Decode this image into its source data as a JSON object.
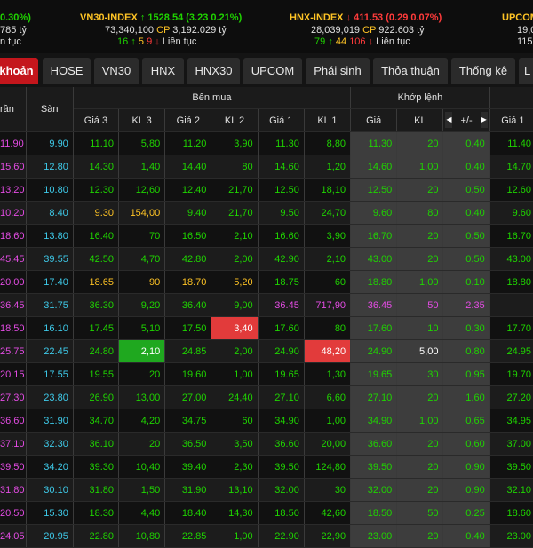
{
  "ticker": {
    "vnindex": {
      "change": "0.30%)",
      "value_line": "785 tỷ",
      "breadth_line": "n tục"
    },
    "vn30": {
      "name": "VN30-INDEX",
      "arrow": "↑",
      "value": "1528.54",
      "change": "(3.23  0.21%)",
      "volume": "73,340,100",
      "cp_label": "CP",
      "value_bn": "3,192.029 tỷ",
      "adv": "16",
      "adv_arrow": "↑",
      "unch": "5",
      "dec": "9",
      "dec_arrow": "↓",
      "session": "Liên tục"
    },
    "hnx": {
      "name": "HNX-INDEX",
      "arrow": "↓",
      "value": "411.53",
      "change": "(0.29  0.07%)",
      "volume": "28,039,019",
      "cp_label": "CP",
      "value_bn": "922.603 tỷ",
      "adv": "79",
      "adv_arrow": "↑",
      "unch": "44",
      "dec": "106",
      "dec_arrow": "↓",
      "session": "Liên tục"
    },
    "upcom": {
      "name": "UPCOM",
      "value_line": "19,0",
      "breadth_line": "115"
    }
  },
  "tabs": [
    "khoản",
    "HOSE",
    "VN30",
    "HNX",
    "HNX30",
    "UPCOM",
    "Phái sinh",
    "Thỏa thuận",
    "Thống kê",
    "L"
  ],
  "headers": {
    "ceiling": "rần",
    "floor": "Sàn",
    "bid_group": "Bên mua",
    "match_group": "Khớp lệnh",
    "bid_p3": "Giá 3",
    "bid_v3": "KL 3",
    "bid_p2": "Giá 2",
    "bid_v2": "KL 2",
    "bid_p1": "Giá 1",
    "bid_v1": "KL 1",
    "match_price": "Giá",
    "match_vol": "KL",
    "match_change": "+/-",
    "ask_p1": "Giá 1",
    "nav_left": "◀",
    "nav_right": "▶"
  },
  "rows": [
    {
      "ceil": "11.90",
      "floor": "9.90",
      "p3": "11.10",
      "v3": "5,80",
      "p2": "11.20",
      "v2": "3,90",
      "p1": "11.30",
      "v1": "8,80",
      "mp": "11.30",
      "mv": "20",
      "chg": "0.40",
      "a1": "11.40"
    },
    {
      "ceil": "15.60",
      "floor": "12.80",
      "p3": "14.30",
      "v3": "1,40",
      "p2": "14.40",
      "v2": "80",
      "p1": "14.60",
      "v1": "1,20",
      "mp": "14.60",
      "mv": "1,00",
      "chg": "0.40",
      "a1": "14.70"
    },
    {
      "ceil": "13.20",
      "floor": "10.80",
      "p3": "12.30",
      "v3": "12,60",
      "p2": "12.40",
      "v2": "21,70",
      "p1": "12.50",
      "v1": "18,10",
      "mp": "12.50",
      "mv": "20",
      "chg": "0.50",
      "a1": "12.60"
    },
    {
      "ceil": "10.20",
      "floor": "8.40",
      "p3": "9.30",
      "v3": "154,00",
      "p2": "9.40",
      "v2": "21,70",
      "p1": "9.50",
      "v1": "24,70",
      "mp": "9.60",
      "mv": "80",
      "chg": "0.40",
      "a1": "9.60"
    },
    {
      "ceil": "18.60",
      "floor": "13.80",
      "p3": "16.40",
      "v3": "70",
      "p2": "16.50",
      "v2": "2,10",
      "p1": "16.60",
      "v1": "3,90",
      "mp": "16.70",
      "mv": "20",
      "chg": "0.50",
      "a1": "16.70"
    },
    {
      "ceil": "45.45",
      "floor": "39.55",
      "p3": "42.50",
      "v3": "4,70",
      "p2": "42.80",
      "v2": "2,00",
      "p1": "42.90",
      "v1": "2,10",
      "mp": "43.00",
      "mv": "20",
      "chg": "0.50",
      "a1": "43.00"
    },
    {
      "ceil": "20.00",
      "floor": "17.40",
      "p3": "18.65",
      "v3": "90",
      "p2": "18.70",
      "v2": "5,20",
      "p1": "18.75",
      "v1": "60",
      "mp": "18.80",
      "mv": "1,00",
      "chg": "0.10",
      "a1": "18.80"
    },
    {
      "ceil": "36.45",
      "floor": "31.75",
      "p3": "36.30",
      "v3": "9,20",
      "p2": "36.40",
      "v2": "9,00",
      "p1": "36.45",
      "v1": "717,90",
      "mp": "36.45",
      "mv": "50",
      "chg": "2.35",
      "a1": ""
    },
    {
      "ceil": "18.50",
      "floor": "16.10",
      "p3": "17.45",
      "v3": "5,10",
      "p2": "17.50",
      "v2": "3,40",
      "p1": "17.60",
      "v1": "80",
      "mp": "17.60",
      "mv": "10",
      "chg": "0.30",
      "a1": "17.70"
    },
    {
      "ceil": "25.75",
      "floor": "22.45",
      "p3": "24.80",
      "v3": "2,10",
      "p2": "24.85",
      "v2": "2,00",
      "p1": "24.90",
      "v1": "48,20",
      "mp": "24.90",
      "mv": "5,00",
      "chg": "0.80",
      "a1": "24.95"
    },
    {
      "ceil": "20.15",
      "floor": "17.55",
      "p3": "19.55",
      "v3": "20",
      "p2": "19.60",
      "v2": "1,00",
      "p1": "19.65",
      "v1": "1,30",
      "mp": "19.65",
      "mv": "30",
      "chg": "0.95",
      "a1": "19.70"
    },
    {
      "ceil": "27.30",
      "floor": "23.80",
      "p3": "26.90",
      "v3": "13,00",
      "p2": "27.00",
      "v2": "24,40",
      "p1": "27.10",
      "v1": "6,60",
      "mp": "27.10",
      "mv": "20",
      "chg": "1.60",
      "a1": "27.20"
    },
    {
      "ceil": "36.60",
      "floor": "31.90",
      "p3": "34.70",
      "v3": "4,20",
      "p2": "34.75",
      "v2": "60",
      "p1": "34.90",
      "v1": "1,00",
      "mp": "34.90",
      "mv": "1,00",
      "chg": "0.65",
      "a1": "34.95"
    },
    {
      "ceil": "37.10",
      "floor": "32.30",
      "p3": "36.10",
      "v3": "20",
      "p2": "36.50",
      "v2": "3,50",
      "p1": "36.60",
      "v1": "20,00",
      "mp": "36.60",
      "mv": "20",
      "chg": "0.60",
      "a1": "37.00"
    },
    {
      "ceil": "39.50",
      "floor": "34.20",
      "p3": "39.30",
      "v3": "10,40",
      "p2": "39.40",
      "v2": "2,30",
      "p1": "39.50",
      "v1": "124,80",
      "mp": "39.50",
      "mv": "20",
      "chg": "0.90",
      "a1": "39.50"
    },
    {
      "ceil": "31.80",
      "floor": "30.10",
      "p3": "31.80",
      "v3": "1,50",
      "p2": "31.90",
      "v2": "13,10",
      "p1": "32.00",
      "v1": "30",
      "mp": "32.00",
      "mv": "20",
      "chg": "0.90",
      "a1": "32.10"
    },
    {
      "ceil": "20.50",
      "floor": "15.30",
      "p3": "18.30",
      "v3": "4,40",
      "p2": "18.40",
      "v2": "14,30",
      "p1": "18.50",
      "v1": "42,60",
      "mp": "18.50",
      "mv": "50",
      "chg": "0.25",
      "a1": "18.60"
    },
    {
      "ceil": "24.05",
      "floor": "20.95",
      "p3": "22.80",
      "v3": "10,80",
      "p2": "22.85",
      "v2": "1,00",
      "p1": "22.90",
      "v1": "22,90",
      "mp": "23.00",
      "mv": "20",
      "chg": "0.40",
      "a1": "23.00"
    }
  ],
  "colors": {
    "ceiling": "#e44ce4",
    "floor": "#3ec9e8",
    "up": "#1fd400",
    "down": "#ff3b3b",
    "reference": "#ffc425",
    "active_tab": "#c4161c",
    "flash_up": "#1fa81f",
    "flash_down": "#e23b3b"
  }
}
